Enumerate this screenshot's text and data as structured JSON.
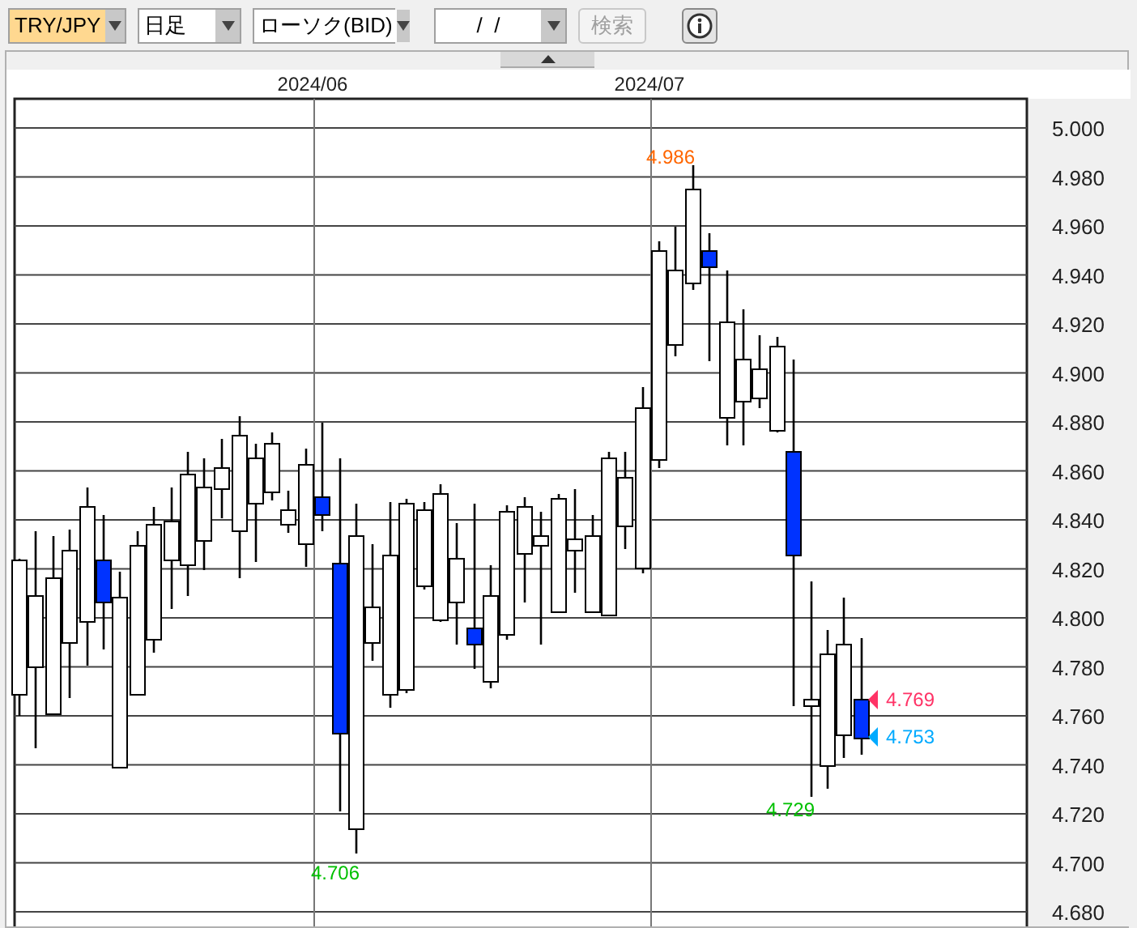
{
  "toolbar": {
    "pair": {
      "value": "TRY/JPY",
      "highlighted": true
    },
    "period": {
      "value": "日足"
    },
    "chart_type": {
      "value": "ローソク(BID)"
    },
    "date": {
      "value": "/  /"
    },
    "search_button": {
      "label": "検索",
      "disabled": true
    }
  },
  "chart": {
    "date_labels": [
      "2024/06",
      "2024/07"
    ],
    "y_axis_labels": [
      "5.000",
      "4.980",
      "4.960",
      "4.940",
      "4.920",
      "4.900",
      "4.880",
      "4.860",
      "4.840",
      "4.820",
      "4.800",
      "4.780",
      "4.760",
      "4.740",
      "4.720",
      "4.700",
      "4.680"
    ],
    "annotations": [
      {
        "text": "4.986",
        "color": "#ff6600"
      },
      {
        "text": "4.706",
        "color": "#00c000"
      },
      {
        "text": "4.729",
        "color": "#00c000"
      }
    ],
    "price_markers": [
      {
        "text": "4.769",
        "color": "#ff3366"
      },
      {
        "text": "4.753",
        "color": "#00aaff"
      }
    ]
  }
}
